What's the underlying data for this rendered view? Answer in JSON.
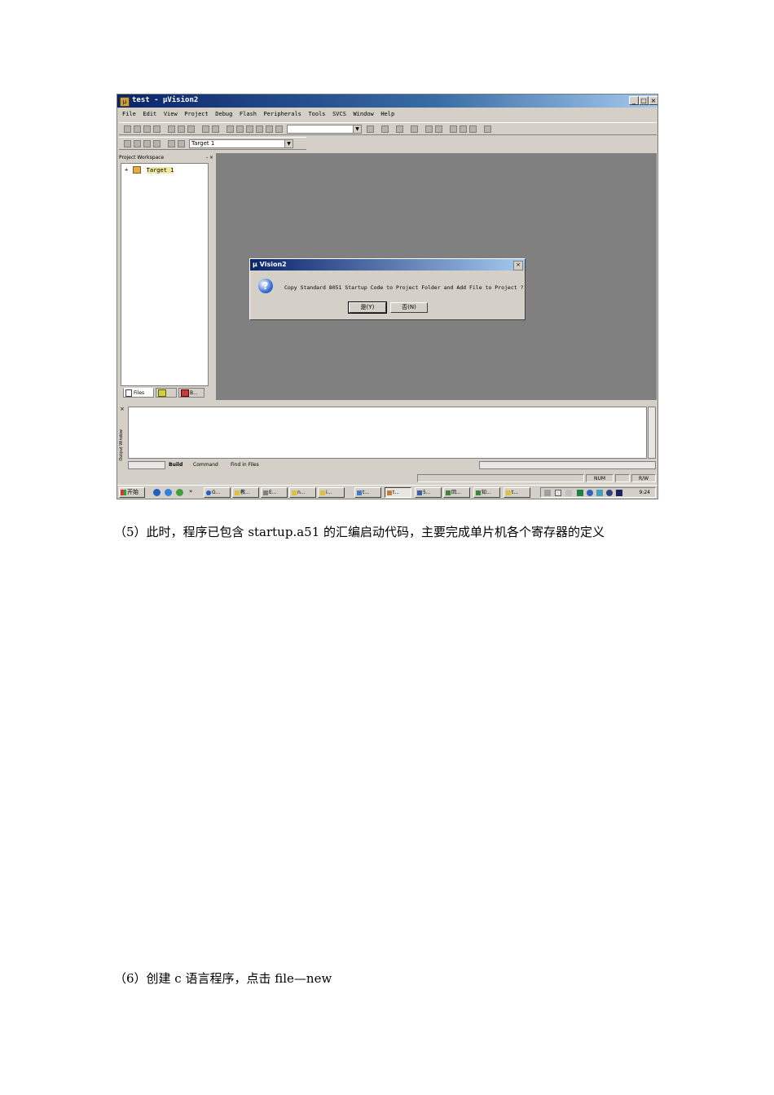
{
  "window": {
    "title": "test  - µVision2",
    "minimize": "_",
    "maximize": "□",
    "close": "×",
    "icon": "uvision-app-icon"
  },
  "menu": [
    "File",
    "Edit",
    "View",
    "Project",
    "Debug",
    "Flash",
    "Peripherals",
    "Tools",
    "SVCS",
    "Window",
    "Help"
  ],
  "toolbar2": {
    "target_select": "Target 1"
  },
  "workspace": {
    "header": "Project Workspace",
    "header_controls": "- ×",
    "tree_node": "Target 1",
    "expander": "+",
    "tabs": [
      "Files",
      "",
      "B..."
    ]
  },
  "dialog": {
    "title": "µ Vision2",
    "close": "×",
    "icon_glyph": "?",
    "message": "Copy Standard 8051 Startup Code to Project Folder and Add File to Project ?",
    "yes_button": "是(Y)",
    "no_button": "否(N)"
  },
  "output": {
    "side_label": "Output Window",
    "close": "×",
    "tabs": [
      "Build",
      "Command",
      "Find in Files"
    ]
  },
  "status": {
    "cells": [
      "",
      "NUM",
      "R/W"
    ]
  },
  "taskbar": {
    "start": "开始",
    "quicklaunch_more": "»",
    "tasks": [
      "G...",
      "教...",
      "E...",
      "n...",
      "i...",
      "t...",
      "t...",
      "5...",
      "回...",
      "知...",
      "t..."
    ],
    "clock": "9:24"
  },
  "doc": {
    "para5": "（5）此时，程序已包含 startup.a51 的汇编启动代码，主要完成单片机各个寄存器的定义",
    "para6": "（6）创建 c 语言程序，点击 file—new"
  }
}
